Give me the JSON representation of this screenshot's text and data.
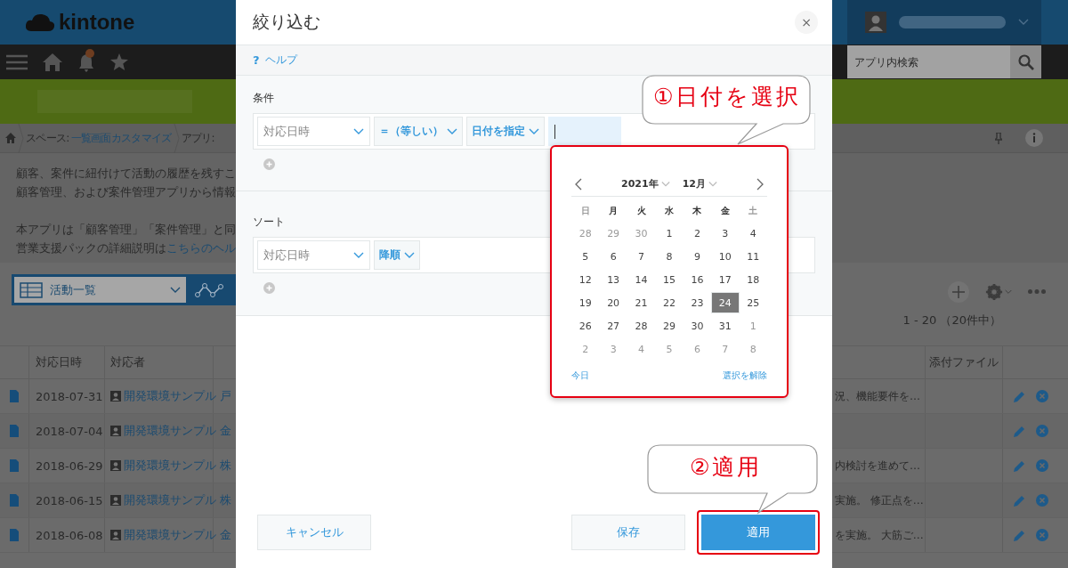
{
  "header": {
    "logo": "kintone",
    "search_placeholder": "アプリ内検索"
  },
  "breadcrumb": {
    "prefix": "スペース: ",
    "space": "一覧画面カスタマイズ",
    "app": "アプリ:"
  },
  "description": [
    {
      "lines": [
        {
          "text": "顧客、案件に紐付けて活動の履歴を残すこ"
        },
        {
          "text": "顧客管理、および案件管理アプリから情報"
        }
      ]
    },
    {
      "lines": [
        {
          "text": "本アプリは「顧客管理」「案件管理」と同"
        },
        {
          "text": "営業支援パックの詳細説明は",
          "link": "こちらのヘル"
        }
      ]
    }
  ],
  "view": {
    "label": "活動一覧"
  },
  "record_count": "1 - 20 （20件中）",
  "table": {
    "columns": [
      "対応日時",
      "対応者"
    ],
    "right_columns": [
      "添付ファイル"
    ],
    "rows": [
      {
        "date": "2018-07-31",
        "assignee": "開発環境サンプル",
        "customer": "戸",
        "summary": "況、機能要件を…"
      },
      {
        "date": "2018-07-04",
        "assignee": "開発環境サンプル",
        "customer": "金"
      },
      {
        "date": "2018-06-29",
        "assignee": "開発環境サンプル",
        "customer": "株",
        "summary": "内検討を進めて…"
      },
      {
        "date": "2018-06-15",
        "assignee": "開発環境サンプル",
        "customer": "株",
        "summary": "実施。 修正点を…"
      },
      {
        "date": "2018-06-08",
        "assignee": "開発環境サンプル",
        "customer": "金",
        "summary": "を実施。 大筋ご…"
      }
    ]
  },
  "dialog": {
    "title": "絞り込む",
    "close": "×",
    "help_mark": "?",
    "help": "ヘルプ",
    "conditions": {
      "label": "条件",
      "field": "対応日時",
      "operator": "＝（等しい）",
      "mode": "日付を指定"
    },
    "sort": {
      "label": "ソート",
      "field": "対応日時",
      "order": "降順"
    },
    "buttons": [
      {
        "label": "キャンセル",
        "kind": "secondary",
        "highlighted": false
      },
      {
        "label": "保存",
        "kind": "secondary",
        "highlighted": false
      },
      {
        "label": "適用",
        "kind": "primary",
        "highlighted": true
      }
    ]
  },
  "calendar": {
    "year": "2021年",
    "month": "12月",
    "weekdays": [
      {
        "label": "日",
        "muted": true
      },
      {
        "label": "月",
        "muted": false
      },
      {
        "label": "火",
        "muted": false
      },
      {
        "label": "水",
        "muted": false
      },
      {
        "label": "木",
        "muted": false
      },
      {
        "label": "金",
        "muted": false
      },
      {
        "label": "土",
        "muted": true
      }
    ],
    "weeks": [
      [
        {
          "day": "28",
          "muted": true,
          "selected": false
        },
        {
          "day": "29",
          "muted": true,
          "selected": false
        },
        {
          "day": "30",
          "muted": true,
          "selected": false
        },
        {
          "day": "1",
          "muted": false,
          "selected": false
        },
        {
          "day": "2",
          "muted": false,
          "selected": false
        },
        {
          "day": "3",
          "muted": false,
          "selected": false
        },
        {
          "day": "4",
          "muted": false,
          "selected": false
        }
      ],
      [
        {
          "day": "5",
          "muted": false,
          "selected": false
        },
        {
          "day": "6",
          "muted": false,
          "selected": false
        },
        {
          "day": "7",
          "muted": false,
          "selected": false
        },
        {
          "day": "8",
          "muted": false,
          "selected": false
        },
        {
          "day": "9",
          "muted": false,
          "selected": false
        },
        {
          "day": "10",
          "muted": false,
          "selected": false
        },
        {
          "day": "11",
          "muted": false,
          "selected": false
        }
      ],
      [
        {
          "day": "12",
          "muted": false,
          "selected": false
        },
        {
          "day": "13",
          "muted": false,
          "selected": false
        },
        {
          "day": "14",
          "muted": false,
          "selected": false
        },
        {
          "day": "15",
          "muted": false,
          "selected": false
        },
        {
          "day": "16",
          "muted": false,
          "selected": false
        },
        {
          "day": "17",
          "muted": false,
          "selected": false
        },
        {
          "day": "18",
          "muted": false,
          "selected": false
        }
      ],
      [
        {
          "day": "19",
          "muted": false,
          "selected": false
        },
        {
          "day": "20",
          "muted": false,
          "selected": false
        },
        {
          "day": "21",
          "muted": false,
          "selected": false
        },
        {
          "day": "22",
          "muted": false,
          "selected": false
        },
        {
          "day": "23",
          "muted": false,
          "selected": false
        },
        {
          "day": "24",
          "muted": false,
          "selected": true
        },
        {
          "day": "25",
          "muted": false,
          "selected": false
        }
      ],
      [
        {
          "day": "26",
          "muted": false,
          "selected": false
        },
        {
          "day": "27",
          "muted": false,
          "selected": false
        },
        {
          "day": "28",
          "muted": false,
          "selected": false
        },
        {
          "day": "29",
          "muted": false,
          "selected": false
        },
        {
          "day": "30",
          "muted": false,
          "selected": false
        },
        {
          "day": "31",
          "muted": false,
          "selected": false
        },
        {
          "day": "1",
          "muted": true,
          "selected": false
        }
      ],
      [
        {
          "day": "2",
          "muted": true,
          "selected": false
        },
        {
          "day": "3",
          "muted": true,
          "selected": false
        },
        {
          "day": "4",
          "muted": true,
          "selected": false
        },
        {
          "day": "5",
          "muted": true,
          "selected": false
        },
        {
          "day": "6",
          "muted": true,
          "selected": false
        },
        {
          "day": "7",
          "muted": true,
          "selected": false
        },
        {
          "day": "8",
          "muted": true,
          "selected": false
        }
      ]
    ],
    "today": "今日",
    "clear": "選択を解除"
  },
  "annotations": [
    {
      "text": "①日付を選択"
    },
    {
      "text": "②適用"
    }
  ]
}
